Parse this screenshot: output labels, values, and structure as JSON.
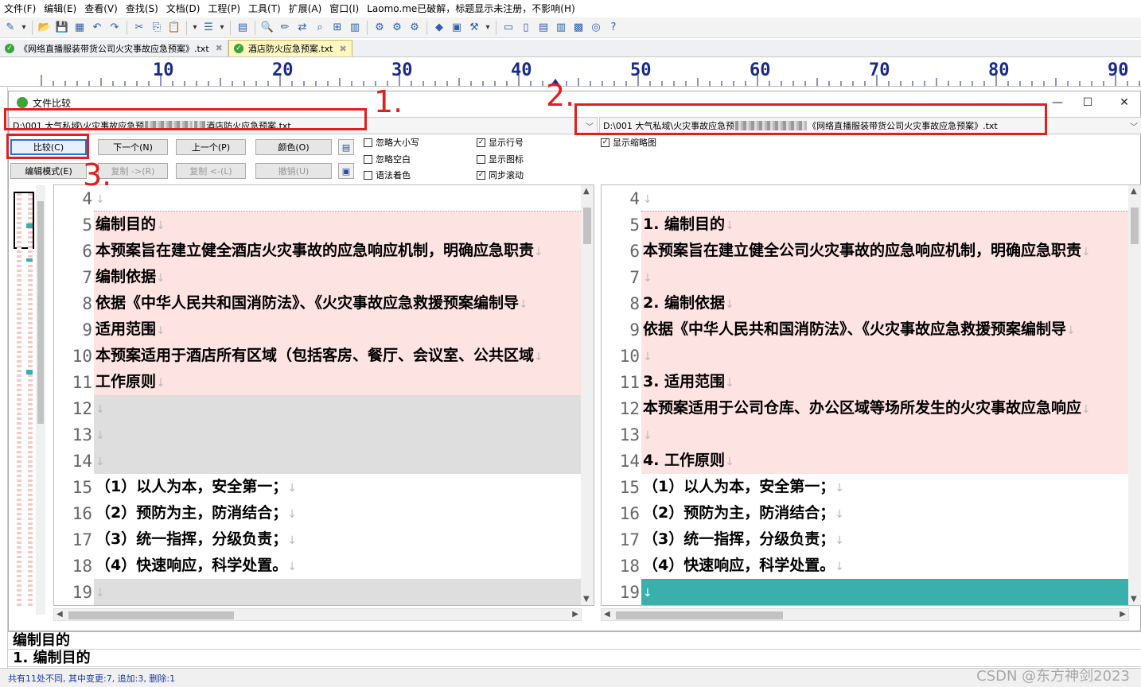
{
  "menu": [
    "文件(F)",
    "编辑(E)",
    "查看(V)",
    "查找(S)",
    "文档(D)",
    "工程(P)",
    "工具(T)",
    "扩展(A)",
    "窗口(I)",
    "Laomo.me已破解，标题显示未注册，不影响(H)"
  ],
  "toolbar_icons": [
    "new-file",
    "dropdown",
    "open",
    "save",
    "save-all",
    "undo",
    "redo",
    "cut",
    "copy",
    "paste",
    "dropdown",
    "wrap",
    "dropdown",
    "list",
    "find",
    "edit",
    "replace",
    "find-in-files",
    "tree",
    "chart",
    "macro-1",
    "macro-2",
    "macro-3",
    "plugin",
    "window",
    "tools",
    "dropdown",
    "panel-1",
    "panel-2",
    "panel-3",
    "panel-4",
    "image",
    "browser",
    "help"
  ],
  "tabs": [
    {
      "label": "《网络直播服装带货公司火灾事故应急预案》.txt",
      "active": false,
      "close": "✖"
    },
    {
      "label": "酒店防火应急预案.txt",
      "active": true,
      "close": "✖"
    }
  ],
  "ruler": {
    "labels": [
      "10",
      "20",
      "30",
      "40",
      "50",
      "60",
      "70",
      "80",
      "90"
    ]
  },
  "dialog": {
    "title": "文件比较",
    "left_path_prefix": "D:\\001 大气私域\\火灾事故应急预",
    "left_path_suffix": "酒店防火应急预案.txt",
    "right_path_prefix": "D:\\001 大气私域\\火灾事故应急预",
    "right_path_suffix": "《网络直播服装带货公司火灾事故应急预案》.txt",
    "buttons": {
      "compare": "比较(C)",
      "next": "下一个(N)",
      "prev": "上一个(P)",
      "color": "颜色(O)",
      "edit_mode": "编辑模式(E)",
      "copy_right": "复制 ->(R)",
      "copy_left": "复制 <-(L)",
      "undo": "撤销(U)"
    },
    "options": {
      "ignore_case": {
        "label": "忽略大小写",
        "checked": false
      },
      "ignore_space": {
        "label": "忽略空白",
        "checked": false
      },
      "syntax_color": {
        "label": "语法着色",
        "checked": false
      },
      "show_line_numbers": {
        "label": "显示行号",
        "checked": true
      },
      "show_icons": {
        "label": "显示图标",
        "checked": false
      },
      "sync_scroll": {
        "label": "同步滚动",
        "checked": true
      },
      "show_minimap": {
        "label": "显示缩略图",
        "checked": true
      }
    },
    "annotations": [
      "1.",
      "2.",
      "3."
    ],
    "lf": "↓",
    "left_lines": [
      {
        "n": "4",
        "text": "",
        "bg": "none"
      },
      {
        "n": "5",
        "text": "编制目的",
        "bg": "diff"
      },
      {
        "n": "6",
        "text": "本预案旨在建立健全酒店火灾事故的应急响应机制，明确应急职责",
        "bg": "diff"
      },
      {
        "n": "7",
        "text": "编制依据",
        "bg": "diff"
      },
      {
        "n": "8",
        "text": "依据《中华人民共和国消防法》、《火灾事故应急救援预案编制导",
        "bg": "diff"
      },
      {
        "n": "9",
        "text": "适用范围",
        "bg": "diff"
      },
      {
        "n": "10",
        "text": "本预案适用于酒店所有区域（包括客房、餐厅、会议室、公共区域",
        "bg": "diff"
      },
      {
        "n": "11",
        "text": "工作原则",
        "bg": "diff"
      },
      {
        "n": "12",
        "text": "",
        "bg": "empty"
      },
      {
        "n": "13",
        "text": "",
        "bg": "empty"
      },
      {
        "n": "14",
        "text": "",
        "bg": "empty"
      },
      {
        "n": "15",
        "text": "（1）以人为本，安全第一；",
        "bg": "none"
      },
      {
        "n": "16",
        "text": "（2）预防为主，防消结合；",
        "bg": "none"
      },
      {
        "n": "17",
        "text": "（3）统一指挥，分级负责；",
        "bg": "none"
      },
      {
        "n": "18",
        "text": "（4）快速响应，科学处置。",
        "bg": "none"
      },
      {
        "n": "19",
        "text": "",
        "bg": "empty"
      }
    ],
    "right_lines": [
      {
        "n": "4",
        "text": "",
        "bg": "none"
      },
      {
        "n": "5",
        "text": "1.  编制目的",
        "bg": "diff"
      },
      {
        "n": "6",
        "text": "本预案旨在建立健全公司火灾事故的应急响应机制，明确应急职责",
        "bg": "diff"
      },
      {
        "n": "7",
        "text": "",
        "bg": "diff"
      },
      {
        "n": "8",
        "text": "2.  编制依据",
        "bg": "diff"
      },
      {
        "n": "9",
        "text": "依据《中华人民共和国消防法》、《火灾事故应急救援预案编制导",
        "bg": "diff"
      },
      {
        "n": "10",
        "text": "",
        "bg": "diff"
      },
      {
        "n": "11",
        "text": "3.  适用范围",
        "bg": "diff"
      },
      {
        "n": "12",
        "text": "本预案适用于公司仓库、办公区域等场所发生的火灾事故应急响应",
        "bg": "diff"
      },
      {
        "n": "13",
        "text": "",
        "bg": "diff"
      },
      {
        "n": "14",
        "text": "4.  工作原则",
        "bg": "diff"
      },
      {
        "n": "15",
        "text": "（1）以人为本，安全第一；",
        "bg": "none"
      },
      {
        "n": "16",
        "text": "（2）预防为主，防消结合；",
        "bg": "none"
      },
      {
        "n": "17",
        "text": "（3）统一指挥，分级负责；",
        "bg": "none"
      },
      {
        "n": "18",
        "text": "（4）快速响应，科学处置。",
        "bg": "none"
      },
      {
        "n": "19",
        "text": "",
        "bg": "teal"
      }
    ],
    "preview_lines": [
      "编制目的",
      "1.  编制目的"
    ]
  },
  "status": "共有11处不同, 其中变更:7, 追加:3, 删除:1",
  "watermark": "CSDN @东方神剑2023",
  "colors": {
    "diff": "#fde3e1",
    "empty": "#dedede",
    "teal": "#3ab0ac",
    "annotation": "#e02020"
  }
}
